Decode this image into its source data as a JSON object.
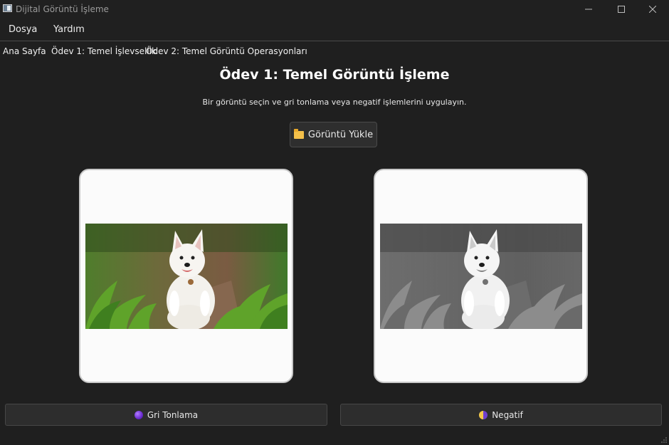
{
  "window": {
    "title": "Dijital Görüntü İşleme",
    "minimize_icon": "minimize-icon",
    "maximize_icon": "maximize-icon",
    "close_icon": "close-icon"
  },
  "menu": [
    "Dosya",
    "Yardım"
  ],
  "tabs": [
    "Ana Sayfa",
    "Ödev 1: Temel İşlevsellik",
    "Ödev 2: Temel Görüntü Operasyonları"
  ],
  "main": {
    "title": "Ödev 1: Temel Görüntü İşleme",
    "subtitle": "Bir görüntü seçin ve gri tonlama veya negatif işlemlerini uygulayın.",
    "load_button": {
      "label": "Görüntü Yükle",
      "icon": "folder-icon"
    },
    "grayscale_button": {
      "label": "Gri Tonlama",
      "icon": "purple-orb-icon"
    },
    "negative_button": {
      "label": "Negatif",
      "icon": "half-circle-icon"
    }
  },
  "colors": {
    "background": "#1f1f1f",
    "panel": "#fbfbfb",
    "button": "#2d2d2d",
    "folder": "#f4c04a",
    "accent_purple": "#6a2bd0"
  }
}
